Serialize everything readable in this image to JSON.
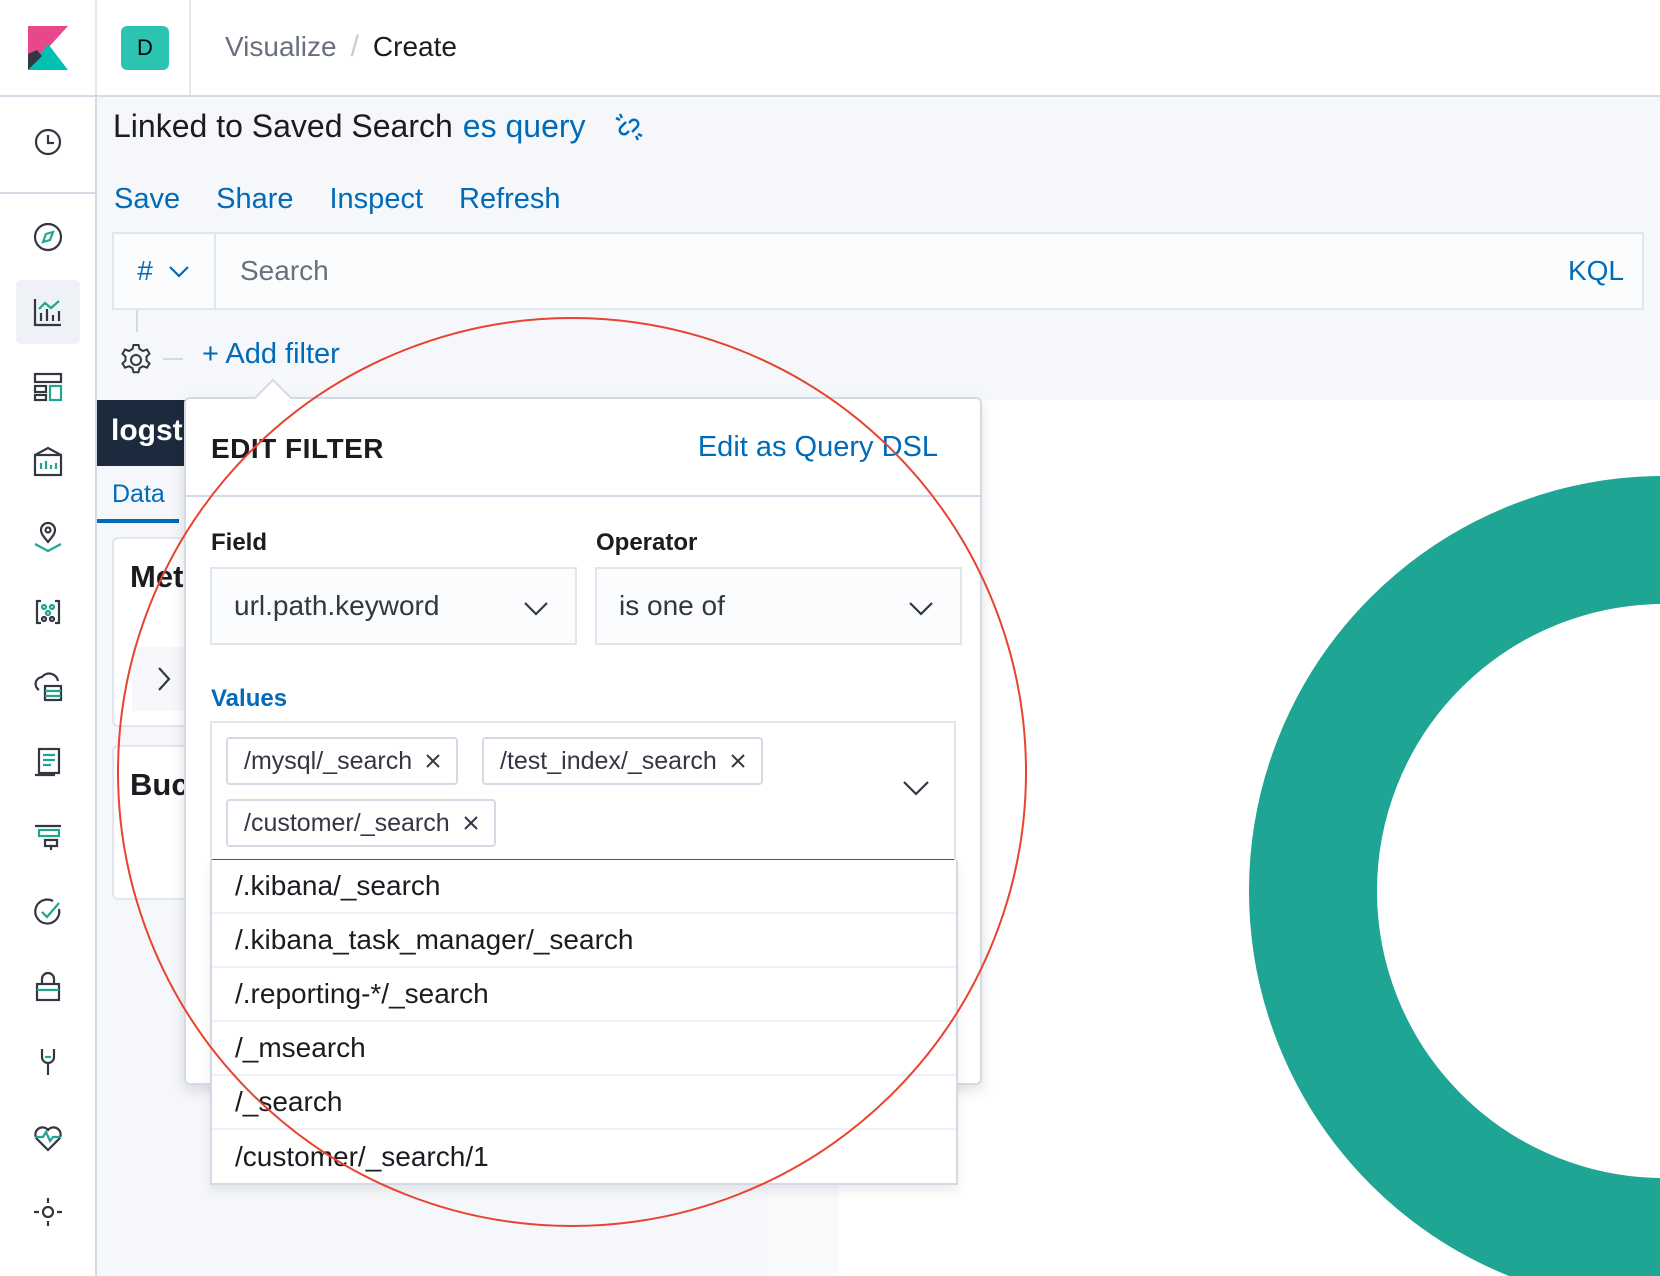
{
  "header": {
    "space_initial": "D",
    "breadcrumbs": [
      "Visualize",
      "Create"
    ],
    "crumb_separator": "/"
  },
  "leftnav": {
    "items": [
      "recently-viewed-icon",
      "discover-icon",
      "visualize-icon",
      "dashboard-icon",
      "canvas-icon",
      "maps-icon",
      "machine-learning-icon",
      "infrastructure-icon",
      "logs-icon",
      "apm-icon",
      "uptime-icon",
      "siem-icon",
      "dev-tools-icon",
      "stack-monitoring-icon",
      "management-icon"
    ],
    "active": "visualize-icon"
  },
  "page": {
    "linked_prefix": "Linked to Saved Search",
    "linked_search": "es query"
  },
  "topnav": {
    "save": "Save",
    "share": "Share",
    "inspect": "Inspect",
    "refresh": "Refresh"
  },
  "querybar": {
    "placeholder": "Search",
    "language": "KQL",
    "syntax_glyph": "#"
  },
  "filters": {
    "add_filter": "+ Add filter"
  },
  "editor": {
    "index_title": "logst",
    "tab_data": "Data",
    "metrics_title": "Met",
    "buckets_title": "Buc"
  },
  "edit_filter": {
    "title": "EDIT FILTER",
    "edit_dsl": "Edit as Query DSL",
    "field_label": "Field",
    "field_value": "url.path.keyword",
    "operator_label": "Operator",
    "operator_value": "is one of",
    "values_label": "Values",
    "selected_values": [
      "/mysql/_search",
      "/test_index/_search",
      "/customer/_search"
    ],
    "options": [
      "/.kibana/_search",
      "/.kibana_task_manager/_search",
      "/.reporting-*/_search",
      "/_msearch",
      "/_search",
      "/customer/_search/1"
    ]
  },
  "colors": {
    "link": "#006bb8",
    "chart_teal": "#1ea593",
    "space_badge": "#2bc4b0",
    "annotation": "#e8432f"
  }
}
